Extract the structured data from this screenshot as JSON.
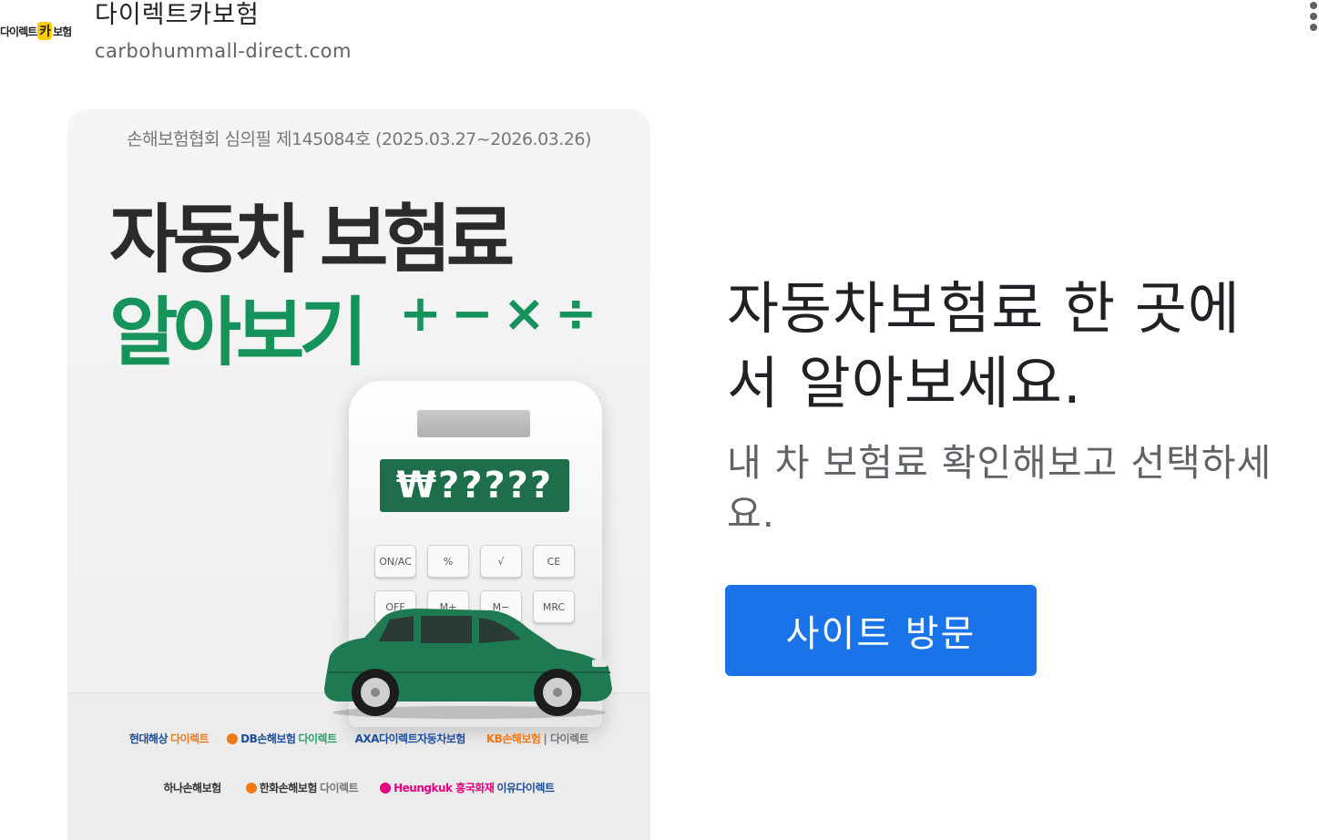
{
  "header": {
    "logo_text_left": "다이렉트",
    "logo_text_mark": "카",
    "logo_text_right": "보험",
    "advertiser_name": "다이렉트카보험",
    "advertiser_url": "carbohummall-direct.com"
  },
  "ad_image": {
    "approval_notice": "손해보험협회 심의필 제145084호 (2025.03.27~2026.03.26)",
    "headline_line1": "자동차 보험료",
    "headline_line2": "알아보기",
    "operators": "+−×÷",
    "calculator_display": "₩?????",
    "calculator_keys": [
      "ON/AC",
      "%",
      "√",
      "CE",
      "OFF",
      "M+",
      "M−",
      "MRC"
    ],
    "insurers_row1": [
      {
        "part1": "현대해상",
        "part2": "다이렉트"
      },
      {
        "part1": "DB손해보험",
        "part2": "다이렉트"
      },
      {
        "part1": "AXA다이렉트자동차보험",
        "part2": ""
      },
      {
        "part1": "KB손해보험",
        "part2": "| 다이렉트"
      }
    ],
    "insurers_row2": [
      {
        "part1": "하나손해보험",
        "part2": ""
      },
      {
        "part1": "한화손해보험",
        "part2": "다이렉트"
      },
      {
        "part1": "Heungkuk 흥국화재",
        "part2": "이유다이렉트"
      }
    ],
    "colors": {
      "brand_green": "#16925b",
      "display_green": "#1f6e4b",
      "logo_yellow": "#ffcc00"
    }
  },
  "ad_text": {
    "title": "자동차보험료 한 곳에서 알아보세요.",
    "description": "내 차 보험료 확인해보고 선택하세요.",
    "cta_label": "사이트 방문",
    "cta_color": "#1a73e8"
  },
  "icons": {
    "menu": "more-vertical-icon"
  }
}
